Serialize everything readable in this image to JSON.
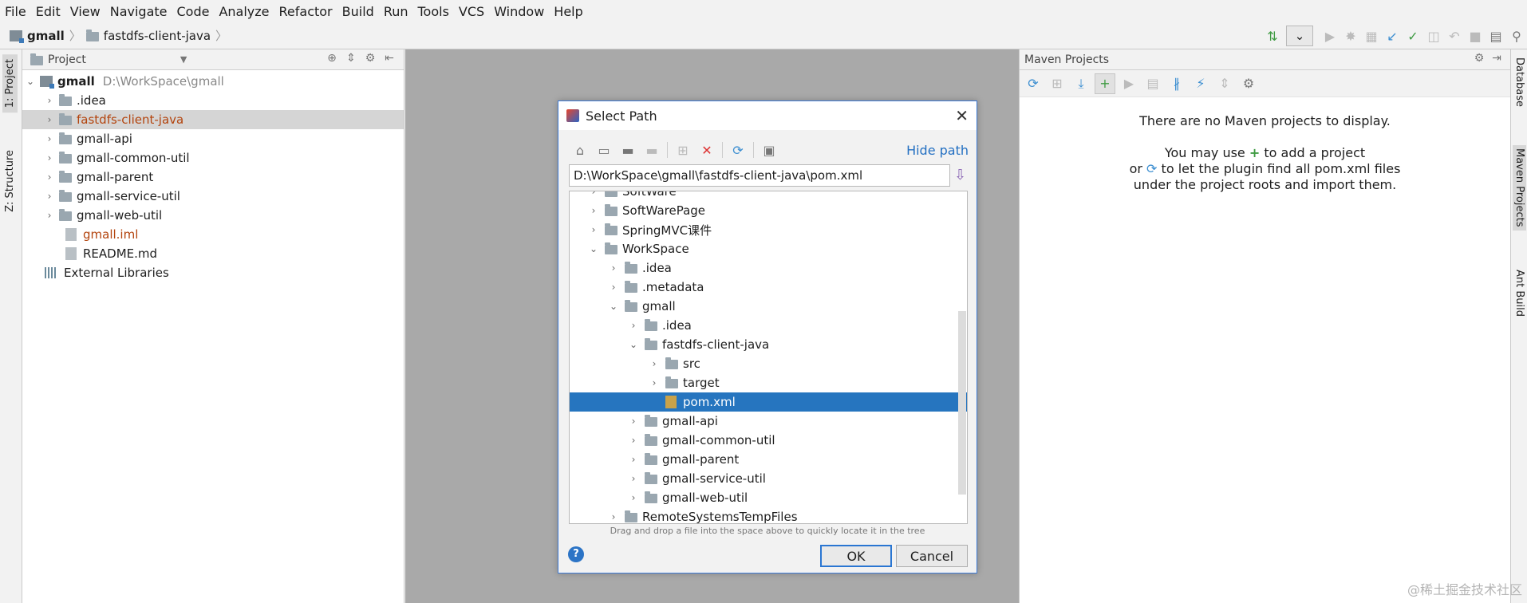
{
  "menu": [
    "File",
    "Edit",
    "View",
    "Navigate",
    "Code",
    "Analyze",
    "Refactor",
    "Build",
    "Run",
    "Tools",
    "VCS",
    "Window",
    "Help"
  ],
  "breadcrumb": {
    "project": "gmall",
    "module": "fastdfs-client-java"
  },
  "left_stripe": {
    "project_tab": "1: Project",
    "structure_tab": "Z: Structure"
  },
  "project_panel": {
    "title": "Project",
    "root": {
      "name": "gmall",
      "path": "D:\\WorkSpace\\gmall"
    },
    "items": [
      ".idea",
      "fastdfs-client-java",
      "gmall-api",
      "gmall-common-util",
      "gmall-parent",
      "gmall-service-util",
      "gmall-web-util"
    ],
    "files": [
      "gmall.iml",
      "README.md"
    ],
    "libraries": "External Libraries"
  },
  "maven_panel": {
    "title": "Maven Projects",
    "message_line1": "There are no Maven projects to display.",
    "message_line2a": "You may use",
    "message_line2b": "to add a project",
    "message_line3a": "or",
    "message_line3b": "to let the plugin find all pom.xml files",
    "message_line4": "under the project roots and import them."
  },
  "right_stripe": {
    "database": "Database",
    "maven": "Maven Projects",
    "ant": "Ant Build"
  },
  "dialog": {
    "title": "Select Path",
    "hide_path": "Hide path",
    "path_value": "D:\\WorkSpace\\gmall\\fastdfs-client-java\\pom.xml",
    "tree": [
      "SoftWare",
      "SoftWarePage",
      "SpringMVC课件",
      "WorkSpace",
      ".idea",
      ".metadata",
      "gmall",
      ".idea",
      "fastdfs-client-java",
      "src",
      "target",
      "pom.xml",
      "gmall-api",
      "gmall-common-util",
      "gmall-parent",
      "gmall-service-util",
      "gmall-web-util",
      "RemoteSystemsTempFiles"
    ],
    "hint": "Drag and drop a file into the space above to quickly locate it in the tree",
    "ok": "OK",
    "cancel": "Cancel",
    "help": "?"
  },
  "watermark": "@稀土掘金技术社区"
}
